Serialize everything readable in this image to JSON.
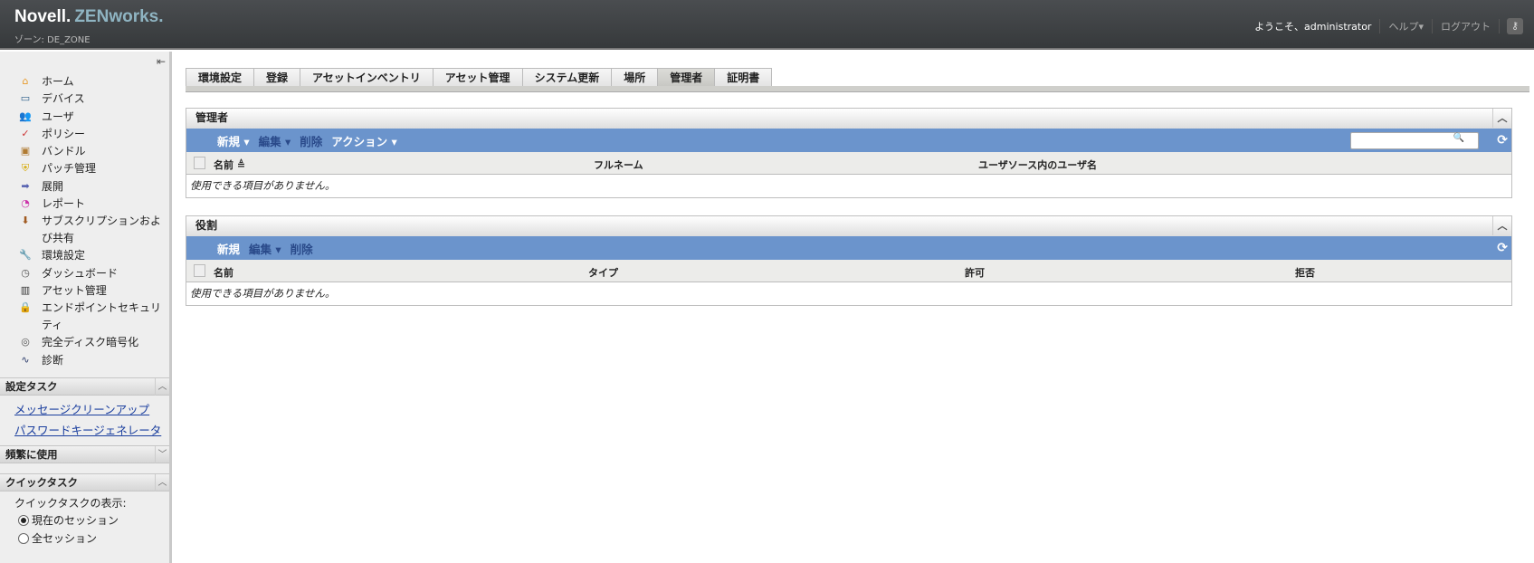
{
  "header": {
    "brand": "Novell.",
    "product": "ZENworks.",
    "zone": "ゾーン: DE_ZONE",
    "welcome": "ようこそ、administrator",
    "help": "ヘルプ▾",
    "logout": "ログアウト"
  },
  "sidebar": {
    "items": [
      {
        "label": "ホーム",
        "icon": "home-icon"
      },
      {
        "label": "デバイス",
        "icon": "monitor-icon"
      },
      {
        "label": "ユーザ",
        "icon": "users-icon"
      },
      {
        "label": "ポリシー",
        "icon": "policy-icon"
      },
      {
        "label": "バンドル",
        "icon": "bundle-icon"
      },
      {
        "label": "パッチ管理",
        "icon": "shield-icon"
      },
      {
        "label": "展開",
        "icon": "deploy-icon"
      },
      {
        "label": "レポート",
        "icon": "report-icon"
      },
      {
        "label": "サブスクリプションおよび共有",
        "icon": "subscription-icon"
      },
      {
        "label": "環境設定",
        "icon": "wrench-icon"
      },
      {
        "label": "ダッシュボード",
        "icon": "gauge-icon"
      },
      {
        "label": "アセット管理",
        "icon": "asset-icon"
      },
      {
        "label": "エンドポイントセキュリティ",
        "icon": "lock-icon"
      },
      {
        "label": "完全ディスク暗号化",
        "icon": "disk-icon"
      },
      {
        "label": "診断",
        "icon": "diagnostics-icon"
      }
    ],
    "config_tasks": {
      "title": "設定タスク",
      "links": [
        "メッセージクリーンアップ",
        "パスワードキージェネレータ"
      ]
    },
    "frequent": {
      "title": "頻繁に使用"
    },
    "quick_tasks": {
      "title": "クイックタスク",
      "show_label": "クイックタスクの表示:",
      "options": [
        "現在のセッション",
        "全セッション"
      ],
      "selected": "現在のセッション"
    }
  },
  "tabs": [
    "環境設定",
    "登録",
    "アセットインベントリ",
    "アセット管理",
    "システム更新",
    "場所",
    "管理者",
    "証明書"
  ],
  "active_tab": "管理者",
  "admins": {
    "title": "管理者",
    "toolbar": [
      "新規 ▾",
      "編集 ▾",
      "削除",
      "アクション ▾"
    ],
    "columns": [
      "名前 ≜",
      "フルネーム",
      "ユーザソース内のユーザ名"
    ],
    "empty": "使用できる項目がありません。"
  },
  "roles": {
    "title": "役割",
    "toolbar": [
      "新規",
      "編集 ▾",
      "削除"
    ],
    "columns": [
      "名前",
      "タイプ",
      "許可",
      "拒否"
    ],
    "empty": "使用できる項目がありません。"
  }
}
